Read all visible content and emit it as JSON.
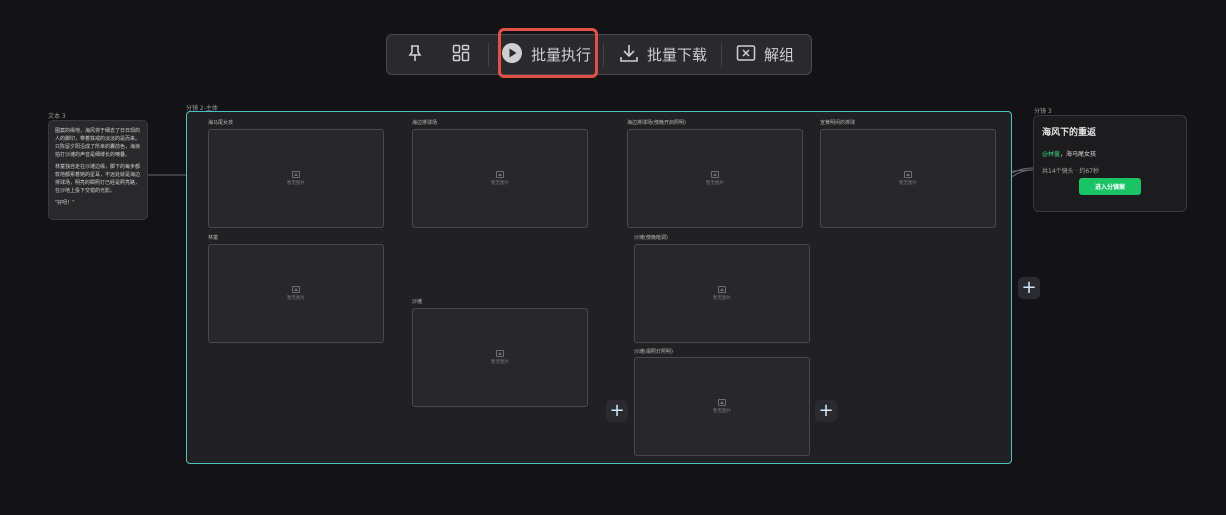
{
  "toolbar": {
    "pin_icon": "pin-icon",
    "layout_icon": "layout-grid-icon",
    "batch_run_label": "批量执行",
    "batch_download_label": "批量下载",
    "ungroup_label": "解组"
  },
  "note": {
    "title": "文本 3",
    "para1": "图案的缘地，海风将于细去了日日现的人的脚印，带着铁戒的淡淡的是而来。只陈留夕阳沿成了所幸的囊前色，海浪拍打沙滩的声音是细缕长的嘀叠。",
    "para2": "林童独自走在沙滩边缘，脚下的每步都软地都累着她的星耳，不远处就是海边排球场，明亮的瞬照灯已经是照亮路，在沙地上投下交错的光影。",
    "para3": "\"好呀！\""
  },
  "group": {
    "title": "分镜 2-主体",
    "placeholder": "暂无图片",
    "nodes": [
      {
        "label": "海马尾女孩"
      },
      {
        "label": "海边排球场"
      },
      {
        "label": "海边排球场(傍晚开启照明)"
      },
      {
        "label": "宣黄明闲的排球"
      },
      {
        "label": "林童"
      },
      {
        "label": "沙滩(傍晚暗调)"
      },
      {
        "label": "沙滩"
      },
      {
        "label": "沙滩(阑照灯照明)"
      }
    ]
  },
  "storyboard": {
    "small_title": "分镜 3",
    "heading": "海风下的重返",
    "tag_highlight": "@林童",
    "tag_rest": "，海马尾女孩",
    "meta": "共14个镜头 · 约67秒",
    "enter_button": "进入分镜案"
  },
  "colors": {
    "accent_green": "#1ac466",
    "highlight_red": "#e2504c",
    "frame_teal": "#4fc2c2"
  }
}
